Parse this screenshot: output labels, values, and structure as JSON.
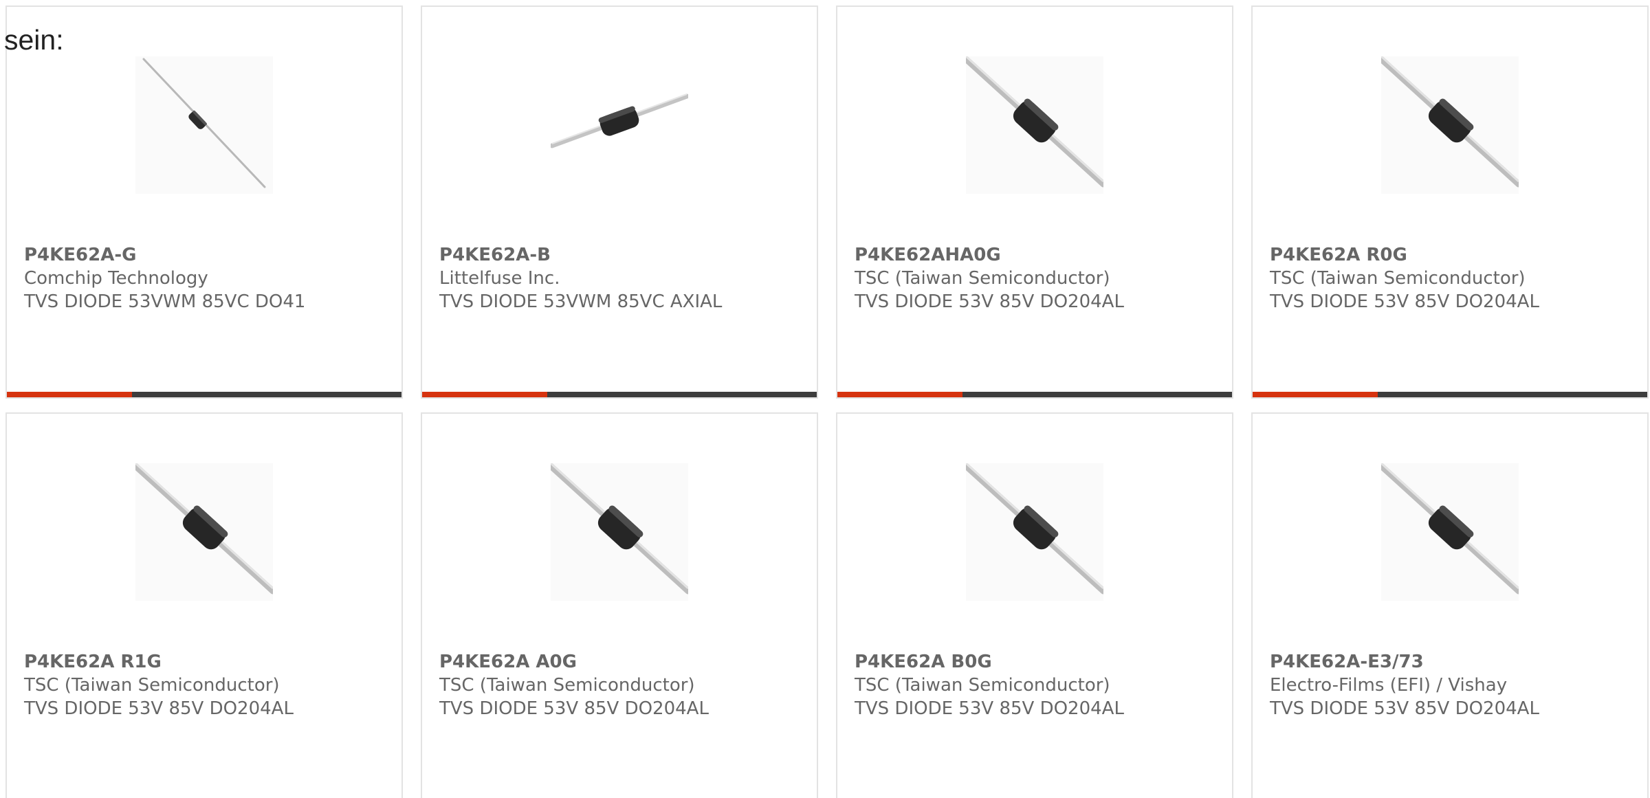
{
  "intro": {
    "text": "sein:"
  },
  "colors": {
    "accent_orange": "#d6330f",
    "bar_dark": "#3d3d3d",
    "card_border": "#e3e3e3",
    "text_gray": "#666666"
  },
  "products": [
    {
      "part": "P4KE62A-G",
      "manufacturer": "Comchip Technology",
      "description": "TVS DIODE 53VWM 85VC DO41",
      "image_icon": "axial-diode-icon"
    },
    {
      "part": "P4KE62A-B",
      "manufacturer": "Littelfuse Inc.",
      "description": "TVS DIODE 53VWM 85VC AXIAL",
      "image_icon": "axial-diode-icon"
    },
    {
      "part": "P4KE62AHA0G",
      "manufacturer": "TSC (Taiwan Semiconductor)",
      "description": "TVS DIODE 53V 85V DO204AL",
      "image_icon": "axial-diode-icon"
    },
    {
      "part": "P4KE62A R0G",
      "manufacturer": "TSC (Taiwan Semiconductor)",
      "description": "TVS DIODE 53V 85V DO204AL",
      "image_icon": "axial-diode-icon"
    },
    {
      "part": "P4KE62A R1G",
      "manufacturer": "TSC (Taiwan Semiconductor)",
      "description": "TVS DIODE 53V 85V DO204AL",
      "image_icon": "axial-diode-icon"
    },
    {
      "part": "P4KE62A A0G",
      "manufacturer": "TSC (Taiwan Semiconductor)",
      "description": "TVS DIODE 53V 85V DO204AL",
      "image_icon": "axial-diode-icon"
    },
    {
      "part": "P4KE62A B0G",
      "manufacturer": "TSC (Taiwan Semiconductor)",
      "description": "TVS DIODE 53V 85V DO204AL",
      "image_icon": "axial-diode-icon"
    },
    {
      "part": "P4KE62A-E3/73",
      "manufacturer": "Electro-Films (EFI) / Vishay",
      "description": "TVS DIODE 53V 85V DO204AL",
      "image_icon": "axial-diode-icon"
    }
  ]
}
